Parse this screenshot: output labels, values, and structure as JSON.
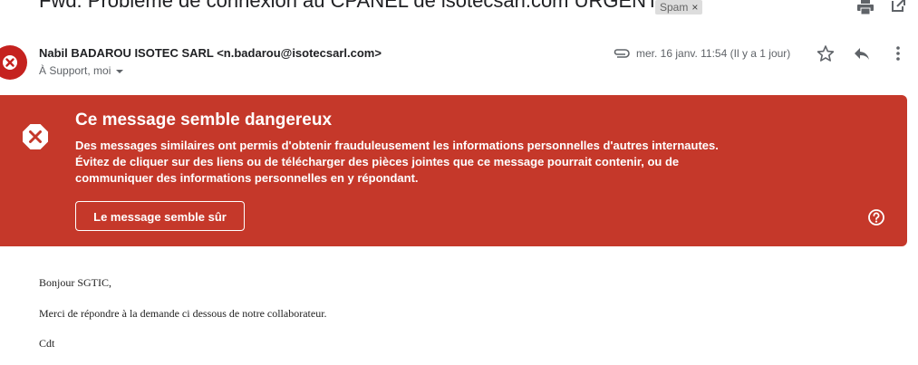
{
  "email": {
    "subject": "Fwd: Problème de connexion au CPANEL de isotecsarl.com URGENT",
    "spam_label": "Spam",
    "spam_remove": "×",
    "sender": "Nabil BADAROU ISOTEC SARL <n.badarou@isotecsarl.com>",
    "recipients": "À Support, moi",
    "date": "mer. 16 janv. 11:54 (Il y a 1 jour)"
  },
  "warning": {
    "title": "Ce message semble dangereux",
    "lines": [
      "Des messages similaires ont permis d'obtenir frauduleusement les informations personnelles d'autres internautes.",
      "Évitez de cliquer sur des liens ou de télécharger des pièces jointes que ce message pourrait contenir, ou de",
      "communiquer des informations personnelles en y répondant."
    ],
    "safe_button": "Le message semble sûr",
    "background_color": "#c5382a"
  },
  "body": {
    "lines": [
      "Bonjour SGTIC,",
      "Merci de répondre à la demande ci dessous de notre collaborateur.",
      "Cdt"
    ]
  },
  "icons": {
    "avatar": "warning-avatar-icon",
    "print": "print-icon",
    "open_new_window": "open-in-new-window-icon",
    "attachment": "paperclip-icon",
    "star": "star-icon",
    "reply": "reply-icon",
    "more": "more-vertical-icon",
    "warning": "danger-octagon-icon",
    "help": "help-circle-icon"
  }
}
